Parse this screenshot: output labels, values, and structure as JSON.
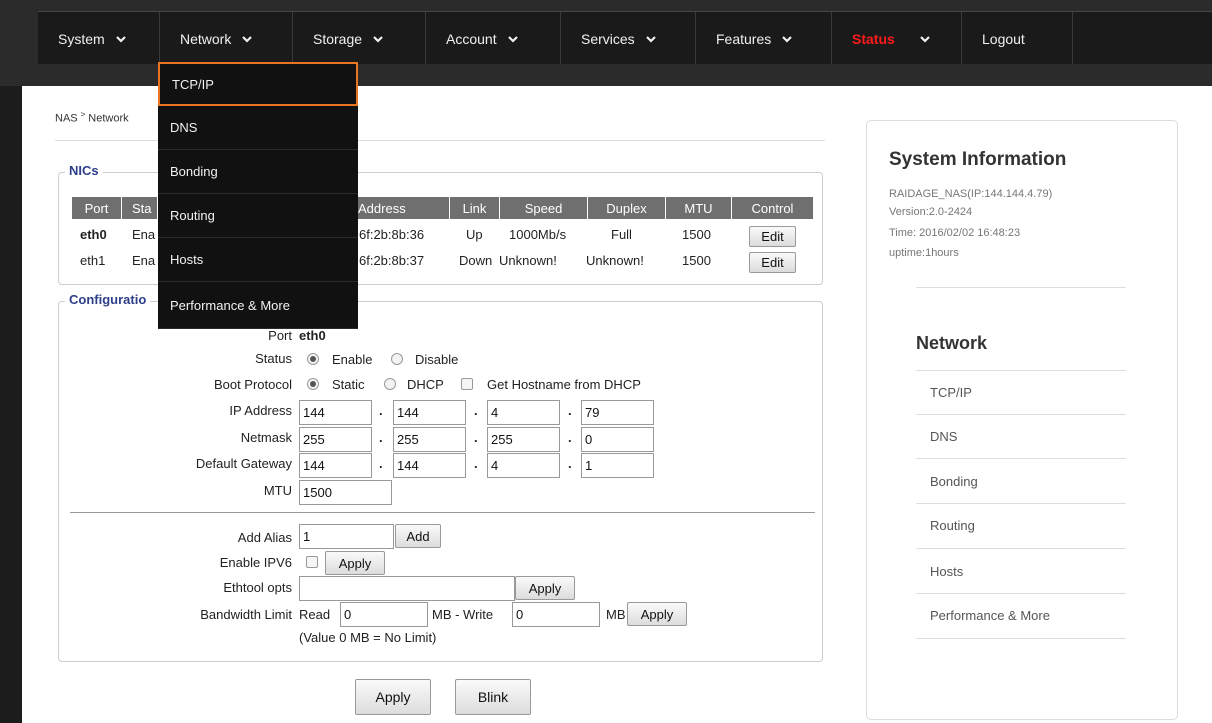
{
  "colors": {
    "accent_orange": "#e8761e",
    "status_red": "#ff1a1a",
    "legend_blue": "#2d3e8a"
  },
  "menu": [
    {
      "label": "System"
    },
    {
      "label": "Network"
    },
    {
      "label": "Storage"
    },
    {
      "label": "Account"
    },
    {
      "label": "Services"
    },
    {
      "label": "Features"
    },
    {
      "label": "Status"
    },
    {
      "label": "Logout"
    }
  ],
  "breadcrumb": {
    "root": "NAS",
    "current": "Network"
  },
  "dropdown": [
    "TCP/IP",
    "DNS",
    "Bonding",
    "Routing",
    "Hosts",
    "Performance & More"
  ],
  "nics": {
    "legend": "NICs",
    "headers": [
      "Port",
      "Sta",
      "Address",
      "Link",
      "Speed",
      "Duplex",
      "MTU",
      "Control"
    ],
    "rows": [
      {
        "port": "eth0",
        "status": "Ena",
        "address": "6f:2b:8b:36",
        "link": "Up",
        "speed": "1000Mb/s",
        "duplex": "Full",
        "mtu": "1500",
        "control": "Edit"
      },
      {
        "port": "eth1",
        "status": "Ena",
        "address": "6f:2b:8b:37",
        "link": "Down",
        "speed": "Unknown!",
        "duplex": "Unknown!",
        "mtu": "1500",
        "control": "Edit"
      }
    ]
  },
  "config": {
    "legend": "Configuratio",
    "port_label": "Port",
    "port_value": "eth0",
    "status_label": "Status",
    "enable": "Enable",
    "disable": "Disable",
    "boot_label": "Boot Protocol",
    "static": "Static",
    "dhcp": "DHCP",
    "hostname_dhcp": "Get Hostname from DHCP",
    "ip_label": "IP Address",
    "ip": [
      "144",
      "144",
      "4",
      "79"
    ],
    "netmask_label": "Netmask",
    "netmask": [
      "255",
      "255",
      "255",
      "0"
    ],
    "gateway_label": "Default Gateway",
    "gateway": [
      "144",
      "144",
      "4",
      "1"
    ],
    "mtu_label": "MTU",
    "mtu": "1500",
    "alias_label": "Add Alias",
    "alias_value": "1",
    "add": "Add",
    "ipv6_label": "Enable IPV6",
    "apply": "Apply",
    "ethtool_label": "Ethtool opts",
    "ethtool_value": "",
    "bw_label": "Bandwidth Limit",
    "read": "Read",
    "read_value": "0",
    "mb_write": "MB - Write",
    "write_value": "0",
    "mb": "MB",
    "bw_note": "(Value 0 MB = No Limit)",
    "dot": "."
  },
  "footer": {
    "apply": "Apply",
    "blink": "Blink"
  },
  "panel": {
    "title": "System Information",
    "host": "RAIDAGE_NAS(IP:144.144.4.79)",
    "version": "Version:2.0-2424",
    "time": "Time: 2016/02/02 16:48:23",
    "uptime": "uptime:1hours",
    "section": "Network",
    "links": [
      "TCP/IP",
      "DNS",
      "Bonding",
      "Routing",
      "Hosts",
      "Performance & More"
    ]
  },
  "icons": {
    "chevron": "chevron-down-icon"
  }
}
